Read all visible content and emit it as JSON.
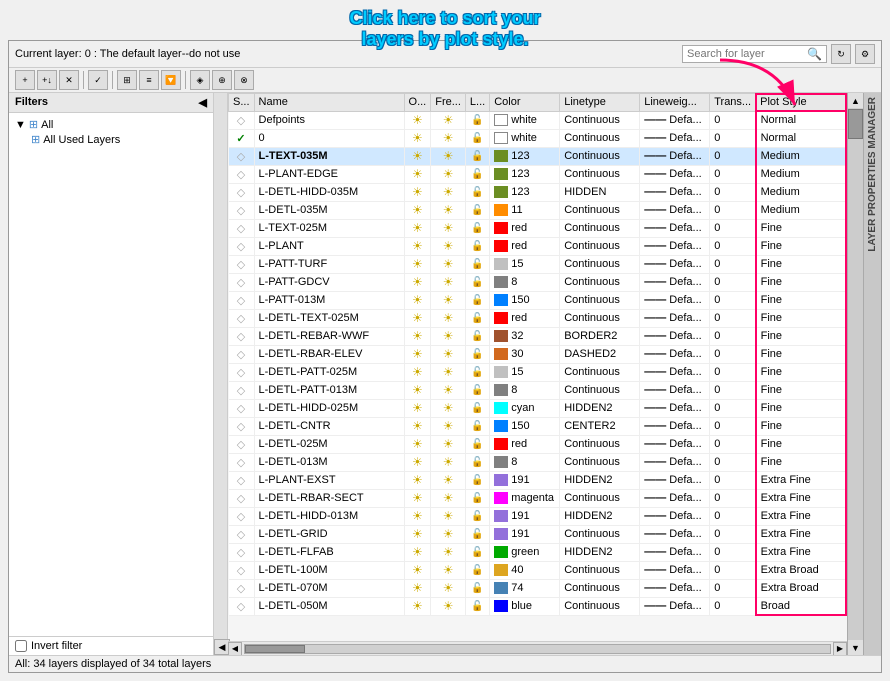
{
  "annotation": {
    "line1": "Click here to sort your",
    "line2": "layers by plot style."
  },
  "header": {
    "current_layer": "Current layer: 0 : The default layer--do not use",
    "search_placeholder": "Search for layer"
  },
  "sidebar": {
    "header": "Filters",
    "tree": [
      {
        "label": "All",
        "type": "root",
        "icon": "filter"
      },
      {
        "label": "All Used Layers",
        "type": "child",
        "icon": "filter"
      }
    ],
    "invert_filter": "Invert filter"
  },
  "table": {
    "columns": [
      "S...",
      "Name",
      "O...",
      "Fre...",
      "L...",
      "Color",
      "Linetype",
      "Lineweig...",
      "Trans...",
      "Plot Style"
    ],
    "rows": [
      {
        "status": "◇",
        "name": "Defpoints",
        "on": "☼",
        "freeze": "☼",
        "lock": "🔓",
        "color_name": "white",
        "color_hex": "#ffffff",
        "linetype": "Continuous",
        "lineweight": "Defa...",
        "trans": "0",
        "plot_style": "Normal"
      },
      {
        "status": "✓",
        "name": "0",
        "on": "☼",
        "freeze": "☼",
        "lock": "🔓",
        "color_name": "white",
        "color_hex": "#ffffff",
        "linetype": "Continuous",
        "lineweight": "Defa...",
        "trans": "0",
        "plot_style": "Normal"
      },
      {
        "status": "◇",
        "name": "L-TEXT-035M",
        "on": "☼",
        "freeze": "☼",
        "lock": "🔓",
        "color_name": "123",
        "color_hex": "#6b8e23",
        "linetype": "Continuous",
        "lineweight": "Defa...",
        "trans": "0",
        "plot_style": "Medium",
        "highlight": true
      },
      {
        "status": "◇",
        "name": "L-PLANT-EDGE",
        "on": "☼",
        "freeze": "☼",
        "lock": "🔓",
        "color_name": "123",
        "color_hex": "#6b8e23",
        "linetype": "Continuous",
        "lineweight": "Defa...",
        "trans": "0",
        "plot_style": "Medium"
      },
      {
        "status": "◇",
        "name": "L-DETL-HIDD-035M",
        "on": "☼",
        "freeze": "☼",
        "lock": "🔓",
        "color_name": "123",
        "color_hex": "#6b8e23",
        "linetype": "HIDDEN",
        "lineweight": "Defa...",
        "trans": "0",
        "plot_style": "Medium"
      },
      {
        "status": "◇",
        "name": "L-DETL-035M",
        "on": "☼",
        "freeze": "☼",
        "lock": "🔓",
        "color_name": "11",
        "color_hex": "#ff8c00",
        "linetype": "Continuous",
        "lineweight": "Defa...",
        "trans": "0",
        "plot_style": "Medium"
      },
      {
        "status": "◇",
        "name": "L-TEXT-025M",
        "on": "☼",
        "freeze": "☼",
        "lock": "🔓",
        "color_name": "red",
        "color_hex": "#ff0000",
        "linetype": "Continuous",
        "lineweight": "Defa...",
        "trans": "0",
        "plot_style": "Fine"
      },
      {
        "status": "◇",
        "name": "L-PLANT",
        "on": "☼",
        "freeze": "☼",
        "lock": "🔓",
        "color_name": "red",
        "color_hex": "#ff0000",
        "linetype": "Continuous",
        "lineweight": "Defa...",
        "trans": "0",
        "plot_style": "Fine"
      },
      {
        "status": "◇",
        "name": "L-PATT-TURF",
        "on": "☼",
        "freeze": "☼",
        "lock": "🔓",
        "color_name": "15",
        "color_hex": "#c0c0c0",
        "linetype": "Continuous",
        "lineweight": "Defa...",
        "trans": "0",
        "plot_style": "Fine"
      },
      {
        "status": "◇",
        "name": "L-PATT-GDCV",
        "on": "☼",
        "freeze": "☼",
        "lock": "🔓",
        "color_name": "8",
        "color_hex": "#808080",
        "linetype": "Continuous",
        "lineweight": "Defa...",
        "trans": "0",
        "plot_style": "Fine"
      },
      {
        "status": "◇",
        "name": "L-PATT-013M",
        "on": "☼",
        "freeze": "☼",
        "lock": "🔓",
        "color_name": "150",
        "color_hex": "#0080ff",
        "linetype": "Continuous",
        "lineweight": "Defa...",
        "trans": "0",
        "plot_style": "Fine"
      },
      {
        "status": "◇",
        "name": "L-DETL-TEXT-025M",
        "on": "☼",
        "freeze": "☼",
        "lock": "🔓",
        "color_name": "red",
        "color_hex": "#ff0000",
        "linetype": "Continuous",
        "lineweight": "Defa...",
        "trans": "0",
        "plot_style": "Fine"
      },
      {
        "status": "◇",
        "name": "L-DETL-REBAR-WWF",
        "on": "☼",
        "freeze": "☼",
        "lock": "🔓",
        "color_name": "32",
        "color_hex": "#a0522d",
        "linetype": "BORDER2",
        "lineweight": "Defa...",
        "trans": "0",
        "plot_style": "Fine"
      },
      {
        "status": "◇",
        "name": "L-DETL-RBAR-ELEV",
        "on": "☼",
        "freeze": "☼",
        "lock": "🔓",
        "color_name": "30",
        "color_hex": "#d2691e",
        "linetype": "DASHED2",
        "lineweight": "Defa...",
        "trans": "0",
        "plot_style": "Fine"
      },
      {
        "status": "◇",
        "name": "L-DETL-PATT-025M",
        "on": "☼",
        "freeze": "☼",
        "lock": "🔓",
        "color_name": "15",
        "color_hex": "#c0c0c0",
        "linetype": "Continuous",
        "lineweight": "Defa...",
        "trans": "0",
        "plot_style": "Fine"
      },
      {
        "status": "◇",
        "name": "L-DETL-PATT-013M",
        "on": "☼",
        "freeze": "☼",
        "lock": "🔓",
        "color_name": "8",
        "color_hex": "#808080",
        "linetype": "Continuous",
        "lineweight": "Defa...",
        "trans": "0",
        "plot_style": "Fine"
      },
      {
        "status": "◇",
        "name": "L-DETL-HIDD-025M",
        "on": "☼",
        "freeze": "☼",
        "lock": "🔓",
        "color_name": "cyan",
        "color_hex": "#00ffff",
        "linetype": "HIDDEN2",
        "lineweight": "Defa...",
        "trans": "0",
        "plot_style": "Fine"
      },
      {
        "status": "◇",
        "name": "L-DETL-CNTR",
        "on": "☼",
        "freeze": "☼",
        "lock": "🔓",
        "color_name": "150",
        "color_hex": "#0080ff",
        "linetype": "CENTER2",
        "lineweight": "Defa...",
        "trans": "0",
        "plot_style": "Fine"
      },
      {
        "status": "◇",
        "name": "L-DETL-025M",
        "on": "☼",
        "freeze": "☼",
        "lock": "🔓",
        "color_name": "red",
        "color_hex": "#ff0000",
        "linetype": "Continuous",
        "lineweight": "Defa...",
        "trans": "0",
        "plot_style": "Fine"
      },
      {
        "status": "◇",
        "name": "L-DETL-013M",
        "on": "☼",
        "freeze": "☼",
        "lock": "🔓",
        "color_name": "8",
        "color_hex": "#808080",
        "linetype": "Continuous",
        "lineweight": "Defa...",
        "trans": "0",
        "plot_style": "Fine"
      },
      {
        "status": "◇",
        "name": "L-PLANT-EXST",
        "on": "☼",
        "freeze": "☼",
        "lock": "🔓",
        "color_name": "191",
        "color_hex": "#9370db",
        "linetype": "HIDDEN2",
        "lineweight": "Defa...",
        "trans": "0",
        "plot_style": "Extra Fine"
      },
      {
        "status": "◇",
        "name": "L-DETL-RBAR-SECT",
        "on": "☼",
        "freeze": "☼",
        "lock": "🔓",
        "color_name": "magenta",
        "color_hex": "#ff00ff",
        "linetype": "Continuous",
        "lineweight": "Defa...",
        "trans": "0",
        "plot_style": "Extra Fine"
      },
      {
        "status": "◇",
        "name": "L-DETL-HIDD-013M",
        "on": "☼",
        "freeze": "☼",
        "lock": "🔓",
        "color_name": "191",
        "color_hex": "#9370db",
        "linetype": "HIDDEN2",
        "lineweight": "Defa...",
        "trans": "0",
        "plot_style": "Extra Fine"
      },
      {
        "status": "◇",
        "name": "L-DETL-GRID",
        "on": "☼",
        "freeze": "☼",
        "lock": "🔓",
        "color_name": "191",
        "color_hex": "#9370db",
        "linetype": "Continuous",
        "lineweight": "Defa...",
        "trans": "0",
        "plot_style": "Extra Fine"
      },
      {
        "status": "◇",
        "name": "L-DETL-FLFAB",
        "on": "☼",
        "freeze": "☼",
        "lock": "🔓",
        "color_name": "green",
        "color_hex": "#00aa00",
        "linetype": "HIDDEN2",
        "lineweight": "Defa...",
        "trans": "0",
        "plot_style": "Extra Fine"
      },
      {
        "status": "◇",
        "name": "L-DETL-100M",
        "on": "☼",
        "freeze": "☼",
        "lock": "🔓",
        "color_name": "40",
        "color_hex": "#dda520",
        "linetype": "Continuous",
        "lineweight": "Defa...",
        "trans": "0",
        "plot_style": "Extra Broad"
      },
      {
        "status": "◇",
        "name": "L-DETL-070M",
        "on": "☼",
        "freeze": "☼",
        "lock": "🔓",
        "color_name": "74",
        "color_hex": "#4682b4",
        "linetype": "Continuous",
        "lineweight": "Defa...",
        "trans": "0",
        "plot_style": "Extra Broad"
      },
      {
        "status": "◇",
        "name": "L-DETL-050M",
        "on": "☼",
        "freeze": "☼",
        "lock": "🔓",
        "color_name": "blue",
        "color_hex": "#0000ff",
        "linetype": "Continuous",
        "lineweight": "Defa...",
        "trans": "0",
        "plot_style": "Broad"
      }
    ]
  },
  "status_bar": {
    "text": "All: 34 layers displayed of 34 total layers"
  },
  "right_panel": {
    "label": "LAYER PROPERTIES MANAGER"
  },
  "toolbar": {
    "buttons": [
      "new",
      "delete",
      "refresh",
      "settings"
    ]
  }
}
